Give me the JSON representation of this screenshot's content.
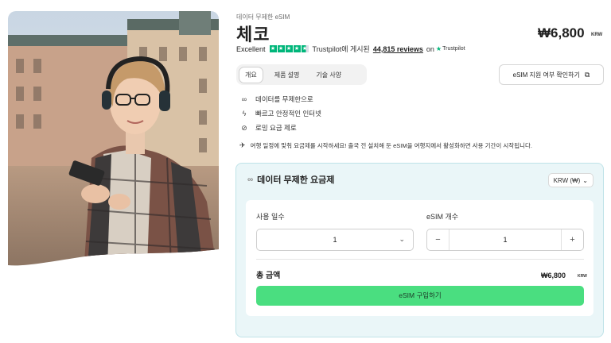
{
  "product": {
    "subtitle": "데이터 무제한 eSIM",
    "title": "체코",
    "price": "₩6,800",
    "price_currency": "KRW"
  },
  "rating": {
    "label": "Excellent",
    "stars": 4.5,
    "text": "Trustpilot에 게시된",
    "reviews": "44,815 reviews",
    "on": "on",
    "brand": "Trustpilot",
    "star_color": "#00b67a"
  },
  "tabs": [
    {
      "label": "개요",
      "active": true
    },
    {
      "label": "제품 설명",
      "active": false
    },
    {
      "label": "기술 사양",
      "active": false
    }
  ],
  "check_button": {
    "label": "eSIM 지원 여부 확인하기",
    "icon": "external-link-icon"
  },
  "features": [
    {
      "icon": "infinity-icon",
      "text": "데이터를 무제한으로"
    },
    {
      "icon": "bolt-icon",
      "text": "빠르고 안정적인 인터넷"
    },
    {
      "icon": "no-roaming-icon",
      "text": "로밍 요금 제로"
    }
  ],
  "notice": {
    "icon": "plane-icon",
    "text": "여행 일정에 맞춰 요금제를 시작하세요! 출국 전 설치해 둔 eSIM을 여행지에서 활성화하면 사용 기간이 시작됩니다."
  },
  "plan": {
    "heading": "데이터 무제한 요금제",
    "currency_select": "KRW (₩)",
    "days_label": "사용 일수",
    "days_value": "1",
    "count_label": "eSIM 개수",
    "count_value": "1",
    "minus": "−",
    "plus": "+",
    "total_label": "총 금액",
    "total_value": "₩6,800",
    "total_currency": "KRW",
    "buy_label": "eSIM 구입하기",
    "accent": "#4ade80",
    "card_bg": "#eaf6f8"
  }
}
